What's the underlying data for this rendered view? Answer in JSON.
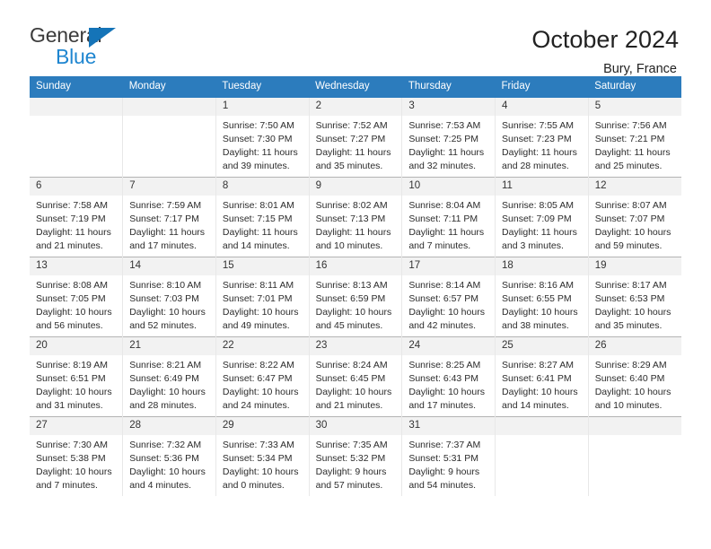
{
  "brand": {
    "name_part1": "General",
    "name_part2": "Blue",
    "triangle_color": "#1574b8",
    "blue_color": "#1f86d0"
  },
  "header": {
    "title": "October 2024",
    "subtitle": "Bury, France"
  },
  "theme": {
    "header_row_bg": "#2c7cbd",
    "daynum_bg": "#f2f2f2",
    "grid_line": "#b4b4b4",
    "text": "#222222"
  },
  "calendar": {
    "weekday_headers": [
      "Sunday",
      "Monday",
      "Tuesday",
      "Wednesday",
      "Thursday",
      "Friday",
      "Saturday"
    ],
    "labels": {
      "sunrise": "Sunrise:",
      "sunset": "Sunset:",
      "daylight": "Daylight:"
    },
    "weeks": [
      [
        {
          "day": "",
          "empty": true
        },
        {
          "day": "",
          "empty": true
        },
        {
          "day": "1",
          "sunrise": "Sunrise: 7:50 AM",
          "sunset": "Sunset: 7:30 PM",
          "daylight_line1": "Daylight: 11 hours",
          "daylight_line2": "and 39 minutes."
        },
        {
          "day": "2",
          "sunrise": "Sunrise: 7:52 AM",
          "sunset": "Sunset: 7:27 PM",
          "daylight_line1": "Daylight: 11 hours",
          "daylight_line2": "and 35 minutes."
        },
        {
          "day": "3",
          "sunrise": "Sunrise: 7:53 AM",
          "sunset": "Sunset: 7:25 PM",
          "daylight_line1": "Daylight: 11 hours",
          "daylight_line2": "and 32 minutes."
        },
        {
          "day": "4",
          "sunrise": "Sunrise: 7:55 AM",
          "sunset": "Sunset: 7:23 PM",
          "daylight_line1": "Daylight: 11 hours",
          "daylight_line2": "and 28 minutes."
        },
        {
          "day": "5",
          "sunrise": "Sunrise: 7:56 AM",
          "sunset": "Sunset: 7:21 PM",
          "daylight_line1": "Daylight: 11 hours",
          "daylight_line2": "and 25 minutes."
        }
      ],
      [
        {
          "day": "6",
          "sunrise": "Sunrise: 7:58 AM",
          "sunset": "Sunset: 7:19 PM",
          "daylight_line1": "Daylight: 11 hours",
          "daylight_line2": "and 21 minutes."
        },
        {
          "day": "7",
          "sunrise": "Sunrise: 7:59 AM",
          "sunset": "Sunset: 7:17 PM",
          "daylight_line1": "Daylight: 11 hours",
          "daylight_line2": "and 17 minutes."
        },
        {
          "day": "8",
          "sunrise": "Sunrise: 8:01 AM",
          "sunset": "Sunset: 7:15 PM",
          "daylight_line1": "Daylight: 11 hours",
          "daylight_line2": "and 14 minutes."
        },
        {
          "day": "9",
          "sunrise": "Sunrise: 8:02 AM",
          "sunset": "Sunset: 7:13 PM",
          "daylight_line1": "Daylight: 11 hours",
          "daylight_line2": "and 10 minutes."
        },
        {
          "day": "10",
          "sunrise": "Sunrise: 8:04 AM",
          "sunset": "Sunset: 7:11 PM",
          "daylight_line1": "Daylight: 11 hours",
          "daylight_line2": "and 7 minutes."
        },
        {
          "day": "11",
          "sunrise": "Sunrise: 8:05 AM",
          "sunset": "Sunset: 7:09 PM",
          "daylight_line1": "Daylight: 11 hours",
          "daylight_line2": "and 3 minutes."
        },
        {
          "day": "12",
          "sunrise": "Sunrise: 8:07 AM",
          "sunset": "Sunset: 7:07 PM",
          "daylight_line1": "Daylight: 10 hours",
          "daylight_line2": "and 59 minutes."
        }
      ],
      [
        {
          "day": "13",
          "sunrise": "Sunrise: 8:08 AM",
          "sunset": "Sunset: 7:05 PM",
          "daylight_line1": "Daylight: 10 hours",
          "daylight_line2": "and 56 minutes."
        },
        {
          "day": "14",
          "sunrise": "Sunrise: 8:10 AM",
          "sunset": "Sunset: 7:03 PM",
          "daylight_line1": "Daylight: 10 hours",
          "daylight_line2": "and 52 minutes."
        },
        {
          "day": "15",
          "sunrise": "Sunrise: 8:11 AM",
          "sunset": "Sunset: 7:01 PM",
          "daylight_line1": "Daylight: 10 hours",
          "daylight_line2": "and 49 minutes."
        },
        {
          "day": "16",
          "sunrise": "Sunrise: 8:13 AM",
          "sunset": "Sunset: 6:59 PM",
          "daylight_line1": "Daylight: 10 hours",
          "daylight_line2": "and 45 minutes."
        },
        {
          "day": "17",
          "sunrise": "Sunrise: 8:14 AM",
          "sunset": "Sunset: 6:57 PM",
          "daylight_line1": "Daylight: 10 hours",
          "daylight_line2": "and 42 minutes."
        },
        {
          "day": "18",
          "sunrise": "Sunrise: 8:16 AM",
          "sunset": "Sunset: 6:55 PM",
          "daylight_line1": "Daylight: 10 hours",
          "daylight_line2": "and 38 minutes."
        },
        {
          "day": "19",
          "sunrise": "Sunrise: 8:17 AM",
          "sunset": "Sunset: 6:53 PM",
          "daylight_line1": "Daylight: 10 hours",
          "daylight_line2": "and 35 minutes."
        }
      ],
      [
        {
          "day": "20",
          "sunrise": "Sunrise: 8:19 AM",
          "sunset": "Sunset: 6:51 PM",
          "daylight_line1": "Daylight: 10 hours",
          "daylight_line2": "and 31 minutes."
        },
        {
          "day": "21",
          "sunrise": "Sunrise: 8:21 AM",
          "sunset": "Sunset: 6:49 PM",
          "daylight_line1": "Daylight: 10 hours",
          "daylight_line2": "and 28 minutes."
        },
        {
          "day": "22",
          "sunrise": "Sunrise: 8:22 AM",
          "sunset": "Sunset: 6:47 PM",
          "daylight_line1": "Daylight: 10 hours",
          "daylight_line2": "and 24 minutes."
        },
        {
          "day": "23",
          "sunrise": "Sunrise: 8:24 AM",
          "sunset": "Sunset: 6:45 PM",
          "daylight_line1": "Daylight: 10 hours",
          "daylight_line2": "and 21 minutes."
        },
        {
          "day": "24",
          "sunrise": "Sunrise: 8:25 AM",
          "sunset": "Sunset: 6:43 PM",
          "daylight_line1": "Daylight: 10 hours",
          "daylight_line2": "and 17 minutes."
        },
        {
          "day": "25",
          "sunrise": "Sunrise: 8:27 AM",
          "sunset": "Sunset: 6:41 PM",
          "daylight_line1": "Daylight: 10 hours",
          "daylight_line2": "and 14 minutes."
        },
        {
          "day": "26",
          "sunrise": "Sunrise: 8:29 AM",
          "sunset": "Sunset: 6:40 PM",
          "daylight_line1": "Daylight: 10 hours",
          "daylight_line2": "and 10 minutes."
        }
      ],
      [
        {
          "day": "27",
          "sunrise": "Sunrise: 7:30 AM",
          "sunset": "Sunset: 5:38 PM",
          "daylight_line1": "Daylight: 10 hours",
          "daylight_line2": "and 7 minutes."
        },
        {
          "day": "28",
          "sunrise": "Sunrise: 7:32 AM",
          "sunset": "Sunset: 5:36 PM",
          "daylight_line1": "Daylight: 10 hours",
          "daylight_line2": "and 4 minutes."
        },
        {
          "day": "29",
          "sunrise": "Sunrise: 7:33 AM",
          "sunset": "Sunset: 5:34 PM",
          "daylight_line1": "Daylight: 10 hours",
          "daylight_line2": "and 0 minutes."
        },
        {
          "day": "30",
          "sunrise": "Sunrise: 7:35 AM",
          "sunset": "Sunset: 5:32 PM",
          "daylight_line1": "Daylight: 9 hours",
          "daylight_line2": "and 57 minutes."
        },
        {
          "day": "31",
          "sunrise": "Sunrise: 7:37 AM",
          "sunset": "Sunset: 5:31 PM",
          "daylight_line1": "Daylight: 9 hours",
          "daylight_line2": "and 54 minutes."
        },
        {
          "day": "",
          "empty": true
        },
        {
          "day": "",
          "empty": true
        }
      ]
    ]
  }
}
